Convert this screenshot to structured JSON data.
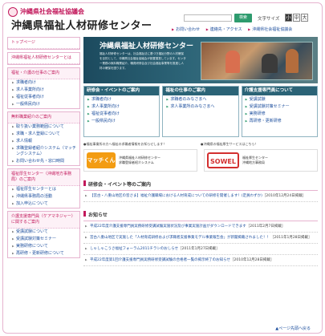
{
  "header": {
    "org_sub": "沖縄県社会福祉協議会",
    "org_main": "沖縄県福祉人材研修センター",
    "search_button": "検索",
    "search_placeholder": "",
    "fontsize_label": "文字サイズ",
    "fontsize_small": "小",
    "fontsize_medium": "中",
    "fontsize_large": "大",
    "links": [
      "お問い合わせ",
      "連絡先・アクセス",
      "沖縄県社会福祉協議会"
    ]
  },
  "sidebar": {
    "top": "トップページ",
    "about": "沖縄県福祉人材研修センターとは",
    "job_head": "福祉・介護の仕事のご案内",
    "job_items": [
      "求職者向け",
      "求人事業所向け",
      "福祉従事者向け",
      "一般県民向け"
    ],
    "free_head": "無料職業紹介のご案内",
    "free_items": [
      "取り扱い業務範囲について",
      "求職・求人登録について",
      "求人情報",
      "求職登録者紹介システム（マッチングシステム）",
      "お問い合わせ先・窓口時間"
    ],
    "center_head": "福祉厚生センター（沖縄地方事務局）のご案内",
    "center_items": [
      "福祉厚生センターとは",
      "沖縄県事務局の活動",
      "加入申込について"
    ],
    "care_head": "介護支援専門員（ケアマネジャー）に関するご案内",
    "care_items": [
      "受講試験について",
      "受講試験対策セミナー",
      "実務研修について",
      "再研修・更新研修について"
    ]
  },
  "hero": {
    "title": "沖縄県福祉人材研修センター",
    "text": "福祉人材研修センターは、社会福祉法に基づき福祉分野の人材確保を目的として、沖縄県社会福祉協議会が設置運営しています。センター業務の無料職業紹介、職員研修会及び社会福祉事業等を推進し人材の確保を図ります。"
  },
  "columns": [
    {
      "head": "研修会・イベントのご案内",
      "items": [
        "求職者向け",
        "求人事業所向け",
        "福祉従事者向け",
        "一般県民向け"
      ]
    },
    {
      "head": "福祉の仕事のご案内",
      "items": [
        "求職者のみなさまへ",
        "求人事業所のみなさまへ"
      ]
    },
    {
      "head": "介護支援専門員について",
      "items": [
        "受講試験",
        "受講試験対策セミナー",
        "実務研修",
        "再研修・更新研修"
      ]
    }
  ],
  "banners": {
    "label_left": "●福祉事業所の方へ福祉の求職者情報をお知らせします！",
    "label_right": "●沖縄県の福祉厚生サービスはこちら！",
    "left_logo": "マッチくん",
    "left_text_1": "沖縄県福祉人材研修センター",
    "left_text_2": "求職登録者紹介システム",
    "right_logo": "SOWEL",
    "right_text_1": "福祉厚生センター",
    "right_text_2": "沖縄地方事務局"
  },
  "events": {
    "head": "研修会・イベント等のご案内",
    "items": [
      {
        "text": "【宮古・八重山地区の皆さま】福祉介護職場における人材育成についての研修を開催します！(定員わずか)",
        "date": "［2010年12月24日掲載］"
      }
    ]
  },
  "notices": {
    "head": "お知らせ",
    "items": [
      {
        "text": "平成22年度介護支援専門員実務研修受講試験実施状況及び事業実施計画がダウンロードできます",
        "date": "［2011年2月7日掲載］"
      },
      {
        "text": "宮古八重山地区で実施した「人材育成研修および求職者支援事業モデル事業報告会」が新聞掲載されました！！",
        "date": "［2011年1月28日掲載］"
      },
      {
        "text": "しゃしゃこうさ福祉フォーラム2011チラシのおしらせ",
        "date": "［2011年1月27日掲載］"
      },
      {
        "text": "平成22年度第1回介護支援専門員実務研修受講試験の合格者一覧の掲示終了のお知らせ",
        "date": "［2010年12月28日掲載］"
      }
    ]
  },
  "footer": {
    "pagetop": "▲ページ先頭へ戻る"
  }
}
